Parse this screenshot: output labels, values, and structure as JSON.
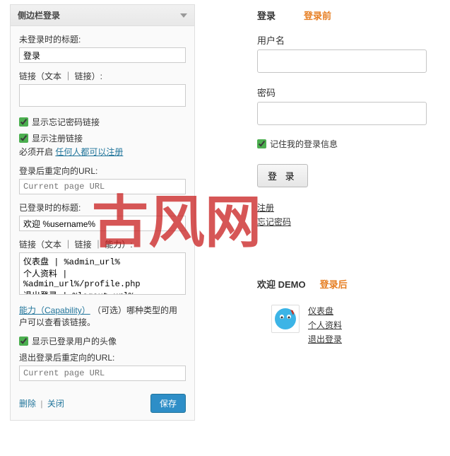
{
  "watermark": "古风网",
  "widget": {
    "title": "侧边栏登录",
    "notLoggedTitleLabel": "未登录时的标题:",
    "notLoggedTitleValue": "登录",
    "linksLabel1": "链接（文本 ｜ 链接）:",
    "linksValue1": "",
    "showForgotLabel": "显示忘记密码链接",
    "showRegisterLabel": "显示注册链接",
    "registerHelper": "必须开启",
    "registerLink": "任何人都可以注册",
    "redirectLoginLabel": "登录后重定向的URL:",
    "redirectLoginPlaceholder": "Current page URL",
    "loggedTitleLabel": "已登录时的标题:",
    "loggedTitleValue": "欢迎 %username%",
    "linksLabel2": "链接（文本 ｜ 链接 ｜ 能力）:",
    "linksValue2": "仪表盘 | %admin_url%\n个人资料 | %admin_url%/profile.php\n退出登录 | %logout_url%",
    "capabilityLink": "能力（Capability）",
    "capabilityHelper": "（可选）哪种类型的用户可以查看该链接。",
    "showAvatarLabel": "显示已登录用户的头像",
    "redirectLogoutLabel": "退出登录后重定向的URL:",
    "redirectLogoutPlaceholder": "Current page URL",
    "deleteLabel": "删除",
    "closeLabel": "关闭",
    "saveLabel": "保存"
  },
  "preview": {
    "loginHeading": "登录",
    "beforeLoginLabel": "登录前",
    "usernameLabel": "用户名",
    "passwordLabel": "密码",
    "rememberLabel": "记住我的登录信息",
    "loginButton": "登 录",
    "registerLink": "注册",
    "forgotLink": "忘记密码",
    "welcomeText": "欢迎 DEMO",
    "afterLoginLabel": "登录后",
    "userLinks": {
      "dashboard": "仪表盘",
      "profile": "个人资料",
      "logout": "退出登录"
    }
  }
}
